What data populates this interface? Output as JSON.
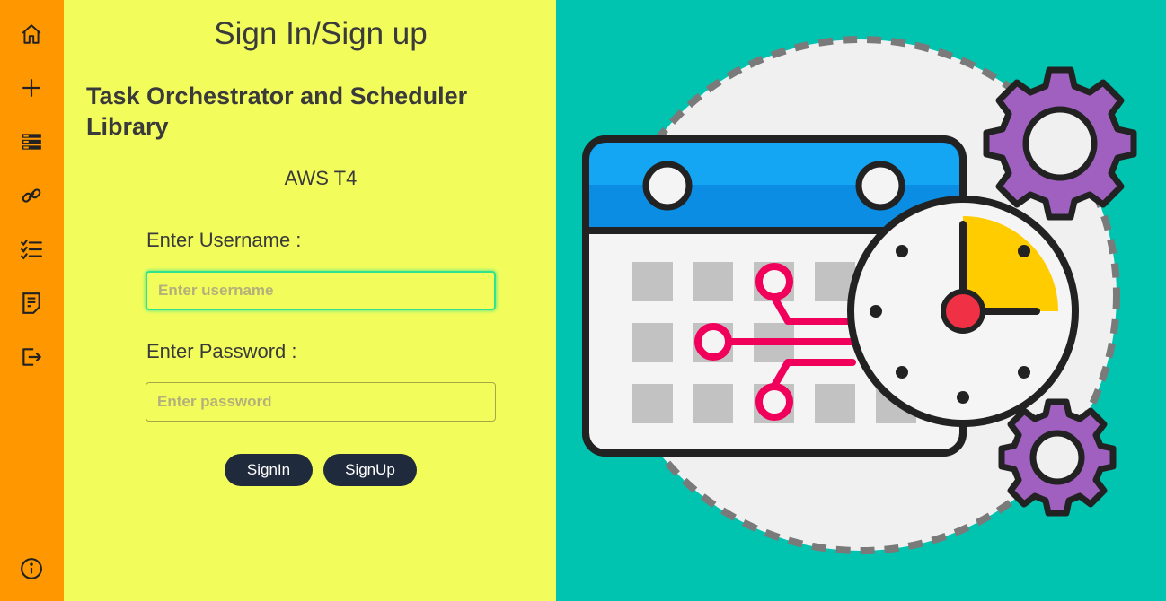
{
  "sidebar": {
    "icons": [
      "home-icon",
      "plus-icon",
      "list-icon",
      "link-icon",
      "checklist-icon",
      "document-icon",
      "logout-icon",
      "info-icon"
    ]
  },
  "page": {
    "title": "Sign In/Sign up",
    "subtitle": "Task Orchestrator and Scheduler Library",
    "tagline": "AWS T4"
  },
  "form": {
    "username_label": "Enter Username :",
    "username_placeholder": "Enter username",
    "username_value": "",
    "password_label": "Enter Password :",
    "password_placeholder": "Enter password",
    "password_value": "",
    "signin_label": "SignIn",
    "signup_label": "SignUp"
  },
  "colors": {
    "sidebar": "#ff9800",
    "panel": "#f2fd5c",
    "illustration_bg": "#00c4b0",
    "button": "#1f2a3d"
  }
}
